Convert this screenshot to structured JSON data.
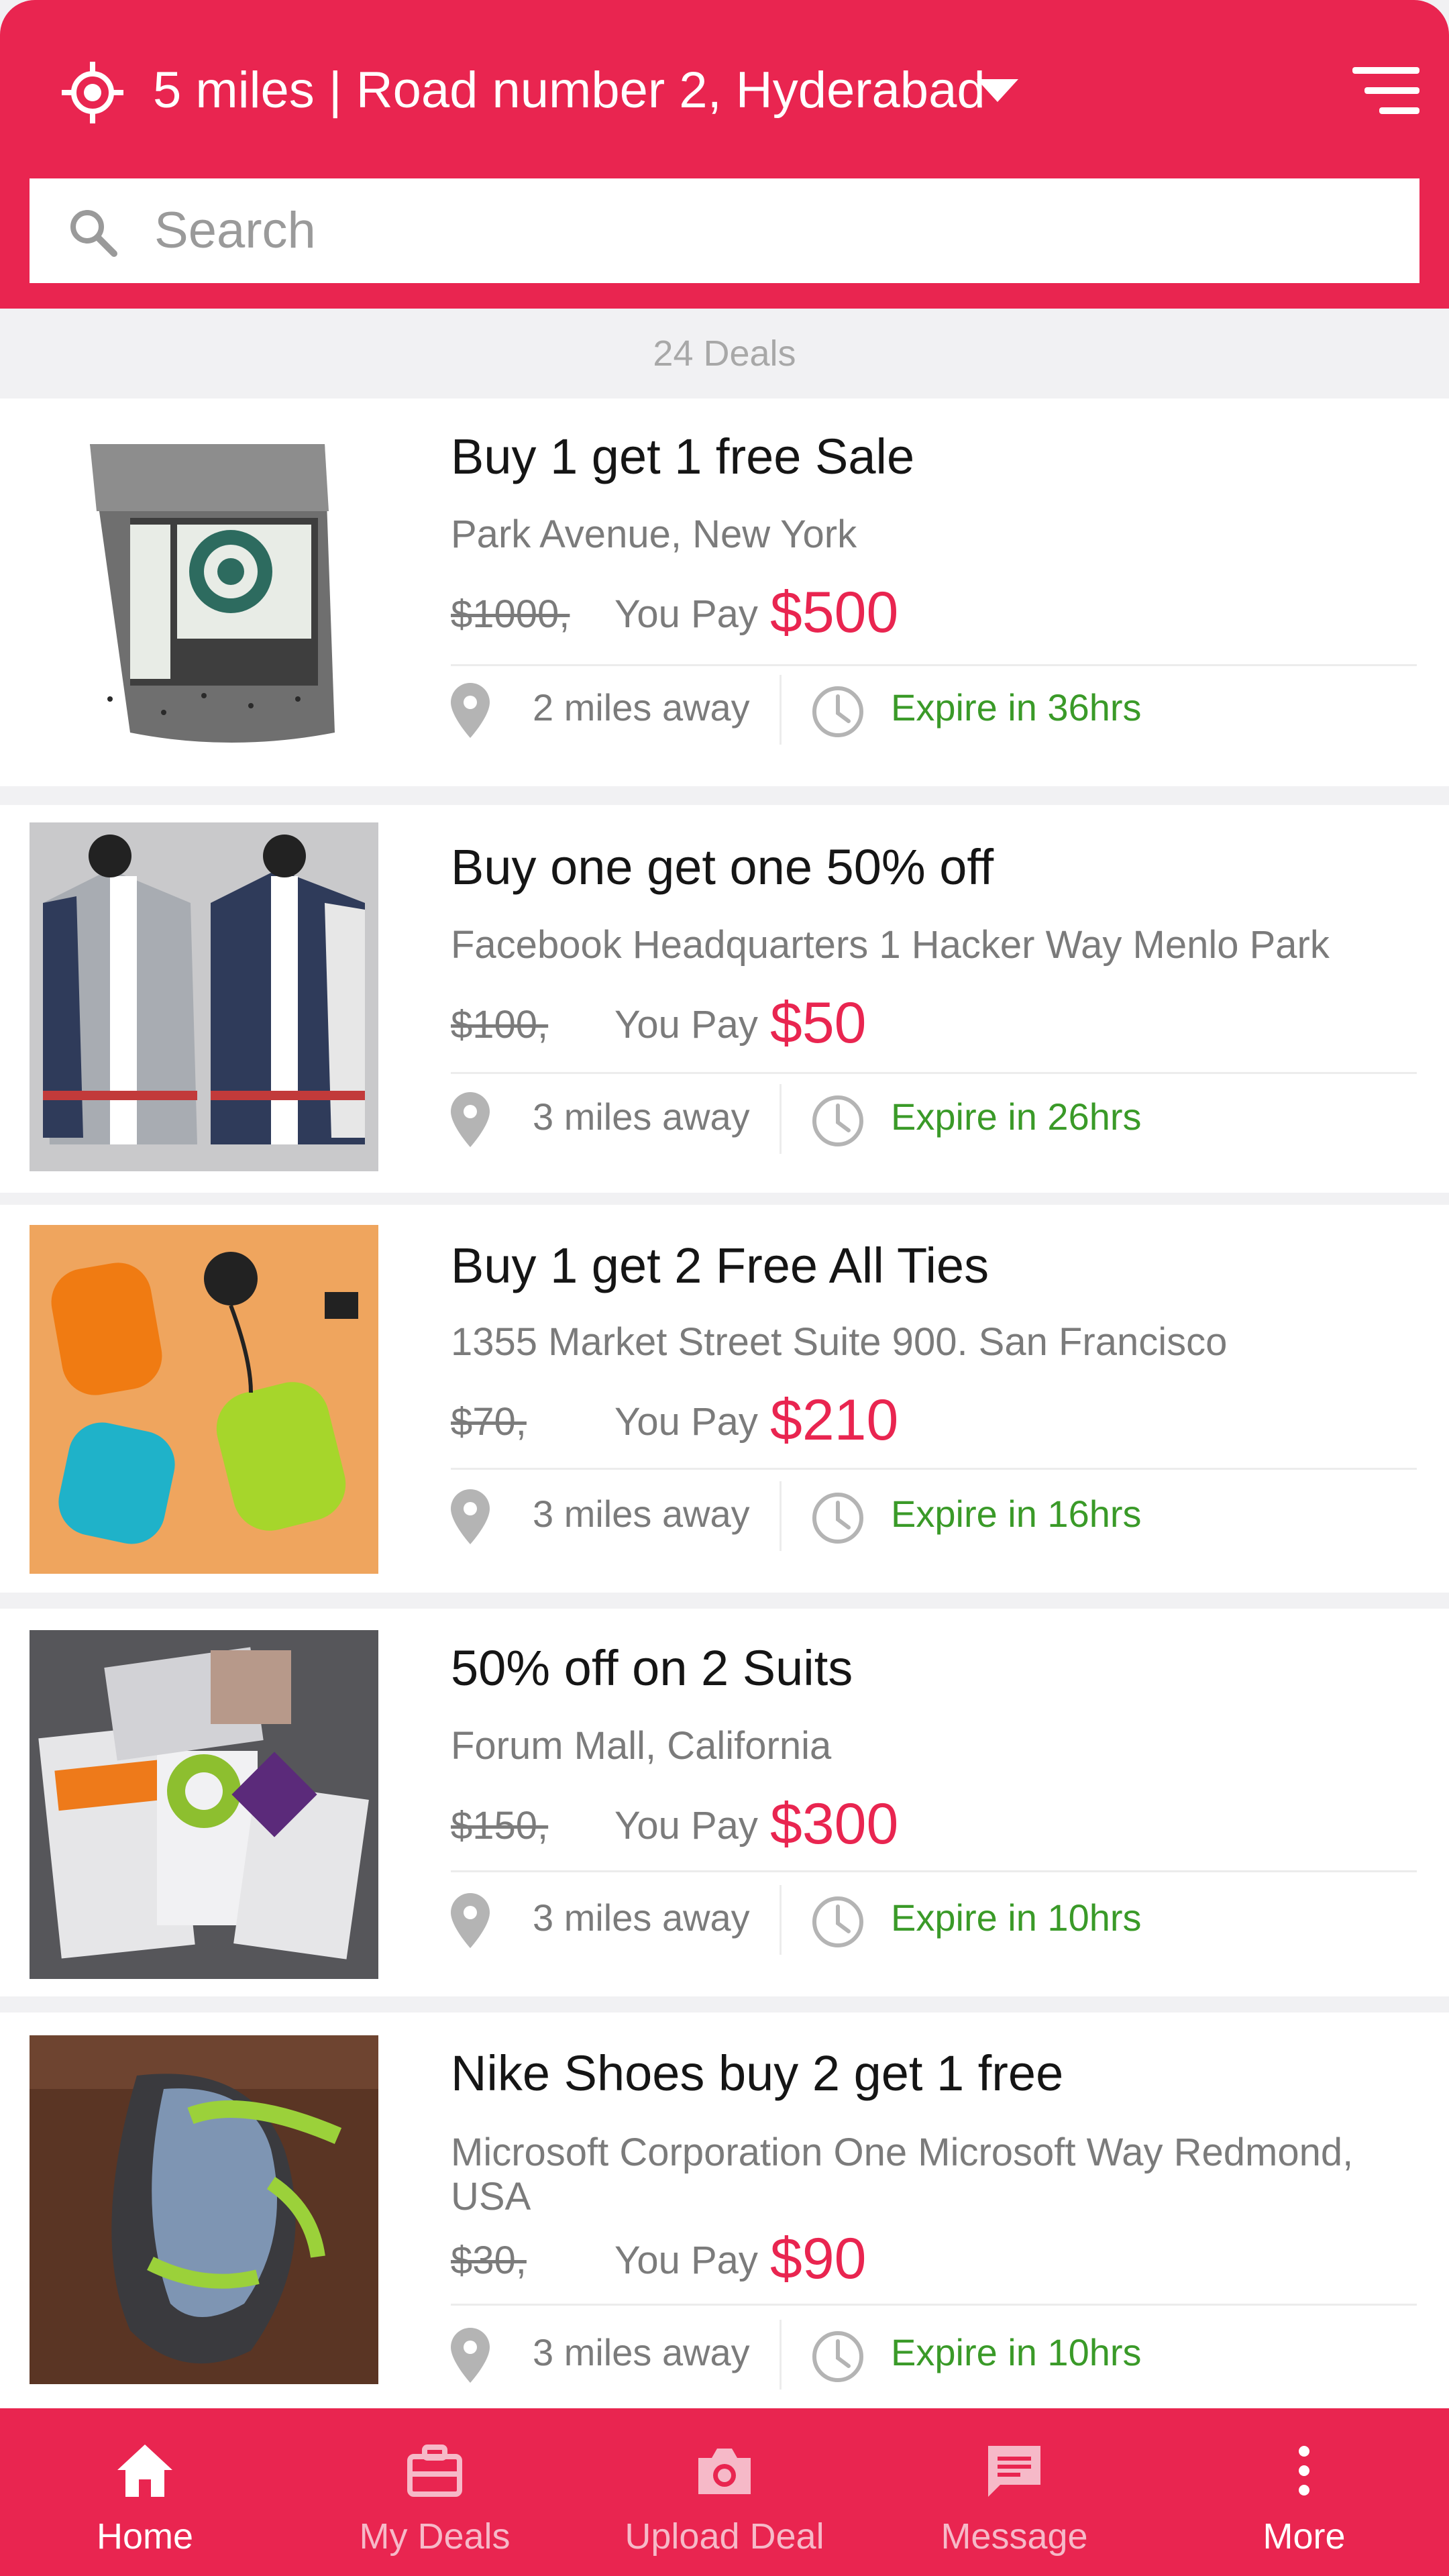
{
  "header": {
    "location": "5 miles | Road number 2, Hyderabad"
  },
  "search": {
    "placeholder": "Search"
  },
  "deals_count": "24 Deals",
  "deals": [
    {
      "title": "Buy 1 get 1 free Sale",
      "address": "Park Avenue, New York",
      "old_price": "$1000,",
      "pay_label": "You Pay",
      "price": "$500",
      "distance": "2 miles away",
      "expire": "Expire in 36hrs",
      "image": "chia-seeds-bag"
    },
    {
      "title": "Buy one get one 50% off",
      "address": "Facebook Headquarters 1 Hacker Way Menlo Park",
      "old_price": "$100,",
      "pay_label": "You Pay",
      "price": "$50",
      "distance": "3 miles away",
      "expire": "Expire in 26hrs",
      "image": "varsity-jackets"
    },
    {
      "title": "Buy 1 get 2 Free All Ties",
      "address": "1355 Market Street Suite 900. San  Francisco",
      "old_price": "$70,",
      "pay_label": "You Pay",
      "price": "$210",
      "distance": "3 miles away",
      "expire": "Expire in 16hrs",
      "image": "computer-mice"
    },
    {
      "title": "50% off on 2 Suits",
      "address": "Forum Mall, California",
      "old_price": "$150,",
      "pay_label": "You Pay",
      "price": "$300",
      "distance": "3 miles away",
      "expire": "Expire in 10hrs",
      "image": "thrive-packets"
    },
    {
      "title": "Nike Shoes buy 2 get 1 free",
      "address": "Microsoft Corporation One Microsoft Way Redmond, USA",
      "old_price": "$30,",
      "pay_label": "You Pay",
      "price": "$90",
      "distance": "3 miles away",
      "expire": "Expire in 10hrs",
      "image": "green-sandal"
    }
  ],
  "nav": [
    {
      "label": "Home",
      "icon": "home-icon",
      "active": true
    },
    {
      "label": "My Deals",
      "icon": "briefcase-icon",
      "active": false
    },
    {
      "label": "Upload Deal",
      "icon": "camera-icon",
      "active": false
    },
    {
      "label": "Message",
      "icon": "message-icon",
      "active": false
    },
    {
      "label": "More",
      "icon": "more-vertical-icon",
      "active": false
    }
  ],
  "colors": {
    "brand": "#e92550",
    "price": "#e92550",
    "expire": "#3a9a28",
    "nav_inactive": "#f6b9c8"
  }
}
